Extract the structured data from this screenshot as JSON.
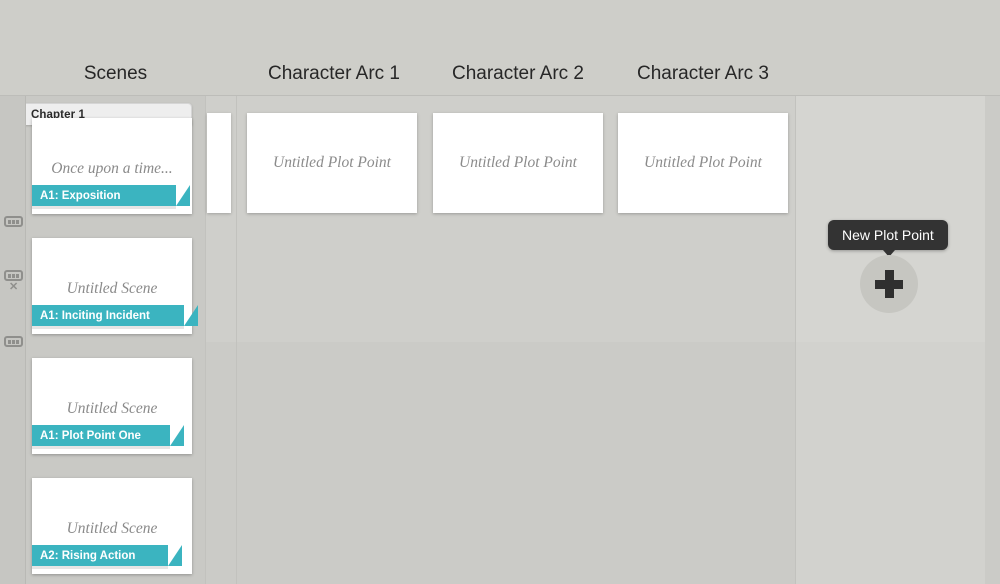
{
  "columns": [
    {
      "id": "scenes",
      "label": "Scenes"
    },
    {
      "id": "character-arc-1",
      "label": "Character Arc 1"
    },
    {
      "id": "character-arc-2",
      "label": "Character Arc 2"
    },
    {
      "id": "character-arc-3",
      "label": "Character Arc 3"
    }
  ],
  "scenes_column": {
    "chapter_label": "Chapter 1",
    "cards": [
      {
        "title": "Once upon a time...",
        "label": "A1: Exposition"
      },
      {
        "title": "Untitled Scene",
        "label": "A1: Inciting Incident"
      },
      {
        "title": "Untitled Scene",
        "label": "A1: Plot Point One"
      },
      {
        "title": "Untitled Scene",
        "label": "A2: Rising Action"
      }
    ]
  },
  "plot_points": [
    {
      "title": "Untitled Plot Point"
    },
    {
      "title": "Untitled Plot Point"
    },
    {
      "title": "Untitled Plot Point"
    }
  ],
  "new_plot_point": {
    "tooltip": "New Plot Point",
    "icon": "plus-icon"
  },
  "gutter": {
    "handles": [
      {
        "icon": "grip-handle-icon",
        "remove": ""
      },
      {
        "icon": "grip-handle-icon",
        "remove": "✕"
      },
      {
        "icon": "grip-handle-icon",
        "remove": ""
      }
    ]
  },
  "colors": {
    "accent_teal": "#3bb4c0",
    "background": "#cfcfcb",
    "tooltip_bg": "#333333",
    "card_bg": "#ffffff",
    "muted_text": "#8a8a8a"
  }
}
